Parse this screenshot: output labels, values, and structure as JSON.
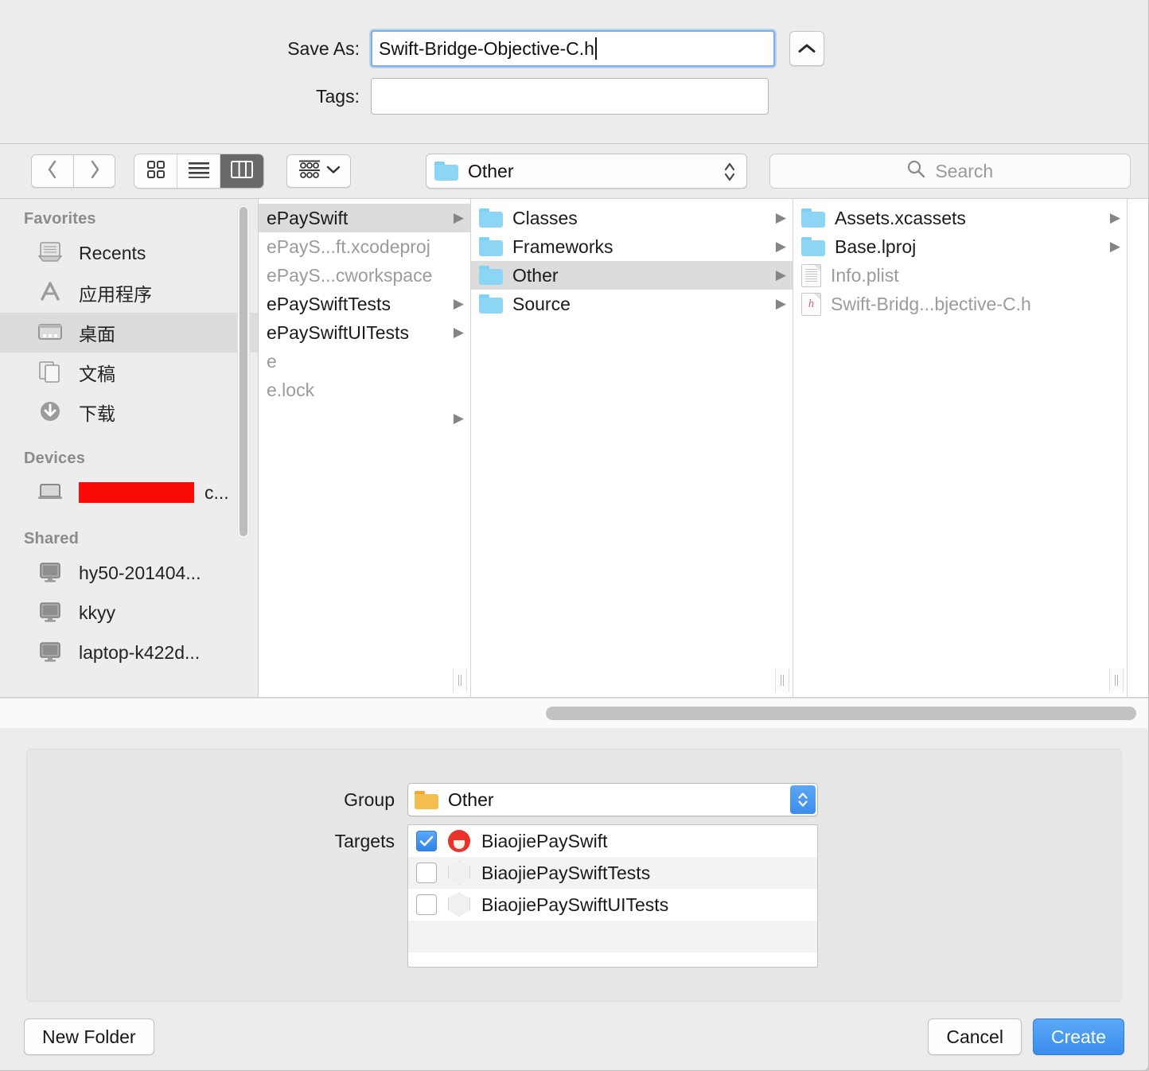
{
  "header": {
    "save_as_label": "Save As:",
    "save_as_value": "Swift-Bridge-Objective-C.h",
    "tags_label": "Tags:",
    "tags_value": "",
    "disclosure_icon": "chevron-up-icon"
  },
  "toolbar": {
    "back_icon": "chevron-left-icon",
    "forward_icon": "chevron-right-icon",
    "view_icon_grid": "icon-view-icon",
    "view_list": "list-view-icon",
    "view_columns": "column-view-icon",
    "selected_view": "column-view-icon",
    "arrange_icon": "arrange-by-icon",
    "arrange_chevron": "chevron-down-icon",
    "path_value": "Other",
    "path_folder_icon": "folder-icon",
    "path_stepper_icon": "up-down-stepper-icon",
    "search_icon": "search-icon",
    "search_placeholder": "Search",
    "search_value": ""
  },
  "sidebar": {
    "sections": [
      {
        "title": "Favorites",
        "items": [
          {
            "label": "Recents",
            "icon": "recents-icon",
            "selected": false
          },
          {
            "label": "应用程序",
            "icon": "applications-icon",
            "selected": false
          },
          {
            "label": "桌面",
            "icon": "desktop-icon",
            "selected": true
          },
          {
            "label": "文稿",
            "icon": "documents-icon",
            "selected": false
          },
          {
            "label": "下载",
            "icon": "downloads-icon",
            "selected": false
          }
        ]
      },
      {
        "title": "Devices",
        "items": [
          {
            "label": "c...",
            "icon": "laptop-icon",
            "selected": false,
            "redacted": true
          }
        ]
      },
      {
        "title": "Shared",
        "items": [
          {
            "label": "hy50-201404...",
            "icon": "display-icon",
            "selected": false
          },
          {
            "label": "kkyy",
            "icon": "display-icon",
            "selected": false
          },
          {
            "label": "laptop-k422d...",
            "icon": "display-icon",
            "selected": false
          }
        ]
      }
    ]
  },
  "columns": [
    {
      "name": "column-1",
      "rows": [
        {
          "label": "ePaySwift",
          "icon": "none",
          "dim": false,
          "selected": true,
          "arrow": true
        },
        {
          "label": "ePayS...ft.xcodeproj",
          "icon": "none",
          "dim": true,
          "selected": false,
          "arrow": false
        },
        {
          "label": "ePayS...cworkspace",
          "icon": "none",
          "dim": true,
          "selected": false,
          "arrow": false
        },
        {
          "label": "ePaySwiftTests",
          "icon": "none",
          "dim": false,
          "selected": false,
          "arrow": true
        },
        {
          "label": "ePaySwiftUITests",
          "icon": "none",
          "dim": false,
          "selected": false,
          "arrow": true
        },
        {
          "label": "e",
          "icon": "none",
          "dim": true,
          "selected": false,
          "arrow": false
        },
        {
          "label": "e.lock",
          "icon": "none",
          "dim": true,
          "selected": false,
          "arrow": false
        },
        {
          "label": "",
          "icon": "none",
          "dim": true,
          "selected": false,
          "arrow": true
        }
      ]
    },
    {
      "name": "column-2",
      "rows": [
        {
          "label": "Classes",
          "icon": "folder-icon",
          "dim": false,
          "selected": false,
          "arrow": true
        },
        {
          "label": "Frameworks",
          "icon": "folder-icon",
          "dim": false,
          "selected": false,
          "arrow": true
        },
        {
          "label": "Other",
          "icon": "folder-icon",
          "dim": false,
          "selected": true,
          "arrow": true
        },
        {
          "label": "Source",
          "icon": "folder-icon",
          "dim": false,
          "selected": false,
          "arrow": true
        }
      ]
    },
    {
      "name": "column-3",
      "rows": [
        {
          "label": "Assets.xcassets",
          "icon": "folder-icon",
          "dim": false,
          "selected": false,
          "arrow": true
        },
        {
          "label": "Base.lproj",
          "icon": "folder-icon",
          "dim": false,
          "selected": false,
          "arrow": true
        },
        {
          "label": "Info.plist",
          "icon": "plist-file-icon",
          "dim": true,
          "selected": false,
          "arrow": false
        },
        {
          "label": "Swift-Bridg...bjective-C.h",
          "icon": "header-file-icon",
          "dim": true,
          "selected": false,
          "arrow": false
        }
      ]
    }
  ],
  "accessory": {
    "group_label": "Group",
    "group_value": "Other",
    "group_folder_icon": "folder-icon",
    "group_stepper_icon": "up-down-stepper-icon",
    "targets_label": "Targets",
    "targets": [
      {
        "label": "BiaojiePaySwift",
        "checked": true,
        "icon": "app-icon"
      },
      {
        "label": "BiaojiePaySwiftTests",
        "checked": false,
        "icon": "test-bundle-icon"
      },
      {
        "label": "BiaojiePaySwiftUITests",
        "checked": false,
        "icon": "test-bundle-icon"
      }
    ]
  },
  "footer": {
    "new_folder_label": "New Folder",
    "cancel_label": "Cancel",
    "create_label": "Create"
  },
  "colors": {
    "accent_blue": "#3a8ced",
    "folder_blue": "#8cd5f5",
    "group_folder_yellow": "#f5bd4e",
    "redaction_red": "#fb0b07",
    "selection_grey": "#dcdcdc"
  }
}
